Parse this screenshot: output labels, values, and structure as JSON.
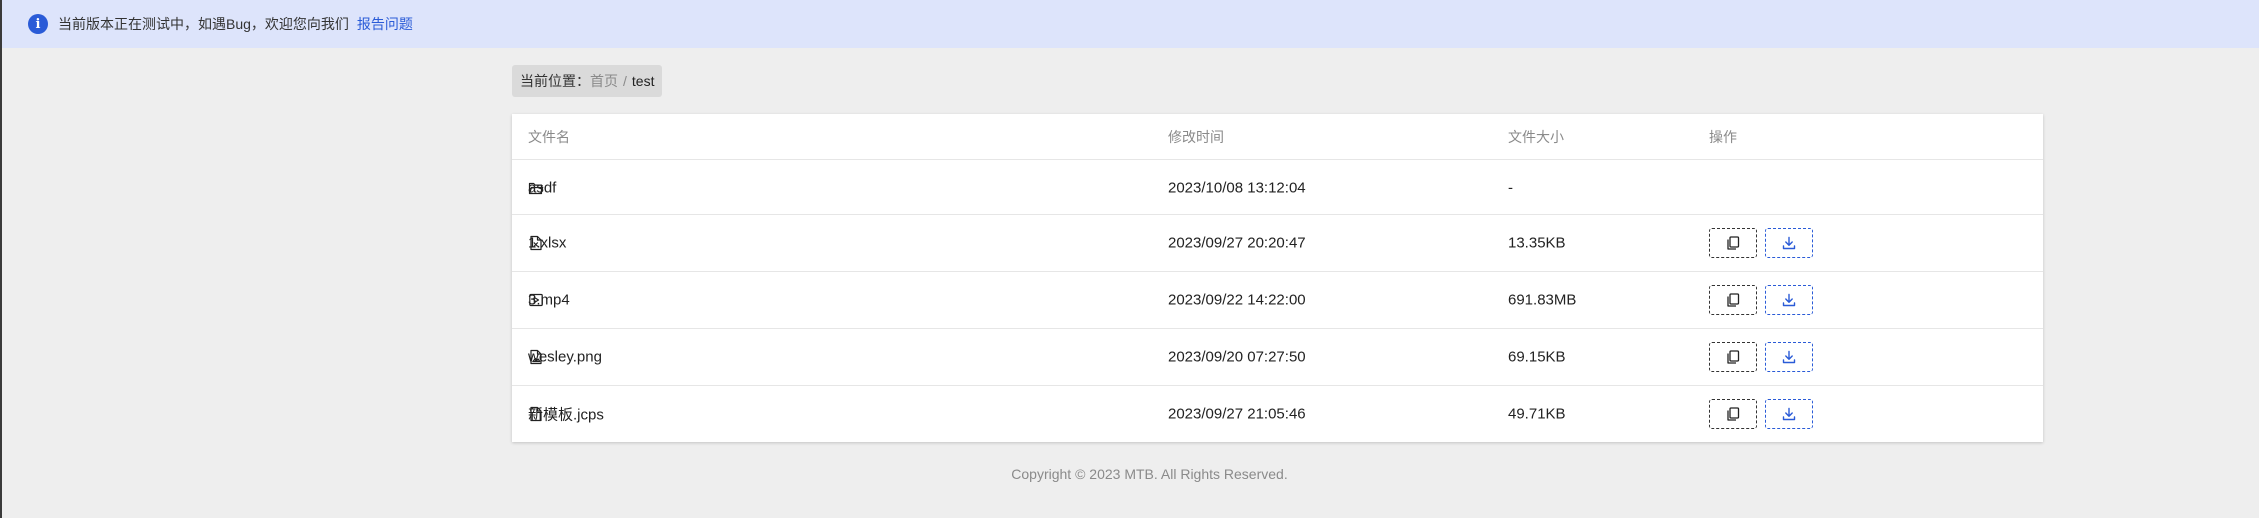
{
  "banner": {
    "icon": "info-icon",
    "message": "当前版本正在测试中，如遇Bug，欢迎您向我们",
    "link_label": "报告问题"
  },
  "breadcrumb": {
    "label": "当前位置：",
    "home": "首页",
    "separator": "/",
    "current": "test"
  },
  "table": {
    "headers": {
      "name": "文件名",
      "modified": "修改时间",
      "size": "文件大小",
      "actions": "操作"
    },
    "rows": [
      {
        "icon": "folder-icon",
        "name": "asdf",
        "modified": "2023/10/08 13:12:04",
        "size": "-",
        "has_actions": false
      },
      {
        "icon": "excel-file-icon",
        "name": "1.xlsx",
        "modified": "2023/09/27 20:20:47",
        "size": "13.35KB",
        "has_actions": true
      },
      {
        "icon": "video-file-icon",
        "name": "3.mp4",
        "modified": "2023/09/22 14:22:00",
        "size": "691.83MB",
        "has_actions": true
      },
      {
        "icon": "image-file-icon",
        "name": "wesley.png",
        "modified": "2023/09/20 07:27:50",
        "size": "69.15KB",
        "has_actions": true
      },
      {
        "icon": "file-icon",
        "name": "新模板.jcps",
        "modified": "2023/09/27 21:05:46",
        "size": "49.71KB",
        "has_actions": true
      }
    ]
  },
  "actions": {
    "copy_icon": "copy-icon",
    "download_icon": "download-icon"
  },
  "footer": {
    "copyright": "Copyright © 2023 MTB. All Rights Reserved."
  },
  "colors": {
    "accent": "#2a5bd7",
    "banner_bg": "#dde4fb",
    "page_bg": "#eeeeee"
  }
}
